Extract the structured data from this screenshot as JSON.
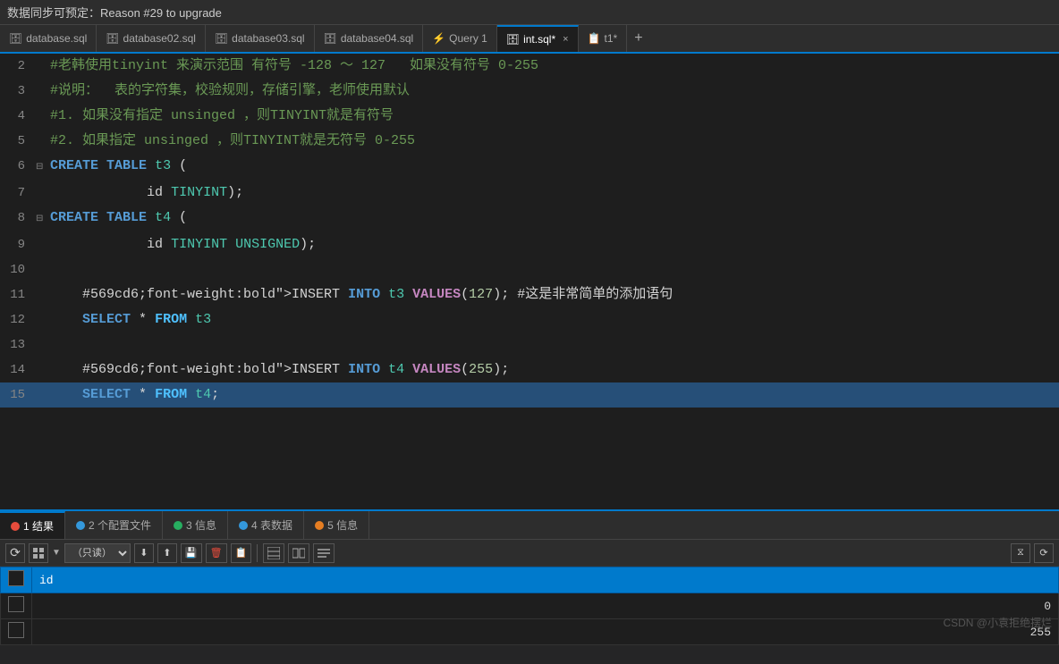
{
  "titleBar": {
    "text": "数据同步可预定：Reason #29 to upgrade"
  },
  "tabs": [
    {
      "id": "tab-database-sql",
      "label": "database.sql",
      "icon": "db-icon",
      "active": false,
      "closable": false
    },
    {
      "id": "tab-database02-sql",
      "label": "database02.sql",
      "icon": "db-icon",
      "active": false,
      "closable": false
    },
    {
      "id": "tab-database03-sql",
      "label": "database03.sql",
      "icon": "db-icon",
      "active": false,
      "closable": false
    },
    {
      "id": "tab-database04-sql",
      "label": "database04.sql",
      "icon": "db-icon",
      "active": false,
      "closable": false
    },
    {
      "id": "tab-query1",
      "label": "Query 1",
      "icon": "query-icon",
      "active": false,
      "closable": false
    },
    {
      "id": "tab-int-sql",
      "label": "int.sql*",
      "icon": "db-icon",
      "active": true,
      "closable": true
    },
    {
      "id": "tab-t1",
      "label": "t1*",
      "icon": "table-icon",
      "active": false,
      "closable": false
    }
  ],
  "codeLines": [
    {
      "num": "2",
      "fold": false,
      "content": "#老韩使用tinyint 来演示范围 有符号 -128 ～ 127   如果没有符号 0-255",
      "type": "comment"
    },
    {
      "num": "3",
      "fold": false,
      "content": "#说明：  表的字符集，校验规则，存储引擎，老师使用默认",
      "type": "comment"
    },
    {
      "num": "4",
      "fold": false,
      "content": "#1. 如果没有指定 unsinged ，则TINYINT就是有符号",
      "type": "comment"
    },
    {
      "num": "5",
      "fold": false,
      "content": "#2. 如果指定 unsinged ，则TINYINT就是无符号 0-255",
      "type": "comment"
    },
    {
      "num": "6",
      "fold": true,
      "content": "CREATE TABLE t3 (",
      "type": "create"
    },
    {
      "num": "7",
      "fold": false,
      "content": "            id TINYINT);",
      "type": "create-body"
    },
    {
      "num": "8",
      "fold": true,
      "content": "CREATE TABLE t4 (",
      "type": "create"
    },
    {
      "num": "9",
      "fold": false,
      "content": "            id TINYINT UNSIGNED);",
      "type": "create-body2"
    },
    {
      "num": "10",
      "fold": false,
      "content": "",
      "type": "empty"
    },
    {
      "num": "11",
      "fold": false,
      "content": "    INSERT INTO t3 VALUES(127); #这是非常简单的添加语句",
      "type": "insert"
    },
    {
      "num": "12",
      "fold": false,
      "content": "    SELECT * FROM t3",
      "type": "select"
    },
    {
      "num": "13",
      "fold": false,
      "content": "",
      "type": "empty"
    },
    {
      "num": "14",
      "fold": false,
      "content": "    INSERT INTO t4 VALUES(255);",
      "type": "insert"
    },
    {
      "num": "15",
      "fold": false,
      "content": "    SELECT * FROM t4;",
      "type": "select-highlighted"
    }
  ],
  "resultTabs": [
    {
      "id": "tab-result-1",
      "label": "1 结果",
      "dotColor": "#e74c3c",
      "active": true
    },
    {
      "id": "tab-config-2",
      "label": "2 个配置文件",
      "dotColor": "#3498db",
      "active": false
    },
    {
      "id": "tab-info-3",
      "label": "3 信息",
      "dotColor": "#27ae60",
      "active": false
    },
    {
      "id": "tab-table-4",
      "label": "4 表数据",
      "dotColor": "#3498db",
      "active": false
    },
    {
      "id": "tab-info-5",
      "label": "5 信息",
      "dotColor": "#e67e22",
      "active": false
    }
  ],
  "toolbar": {
    "readonlyLabel": "（只读）"
  },
  "tableData": {
    "columns": [
      "",
      "id"
    ],
    "rows": [
      {
        "checkbox": "",
        "id": "0"
      },
      {
        "checkbox": "",
        "id": "255"
      }
    ]
  },
  "watermark": "CSDN @小袁拒绝摆烂"
}
